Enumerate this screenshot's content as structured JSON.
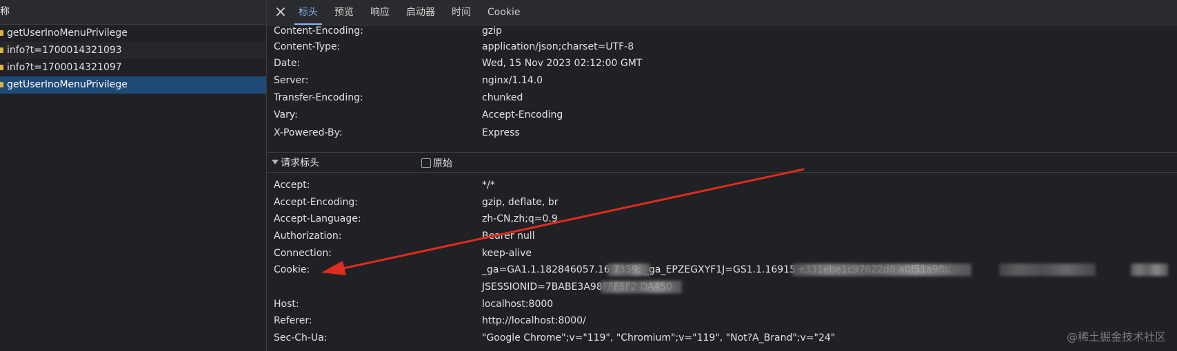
{
  "left_panel": {
    "header": "称",
    "requests": [
      {
        "name": "getUserInoMenuPrivilege"
      },
      {
        "name": "info?t=1700014321093"
      },
      {
        "name": "info?t=1700014321097"
      },
      {
        "name": "getUserInoMenuPrivilege"
      }
    ]
  },
  "tabs": {
    "close_icon": "×",
    "items": [
      {
        "label": "标头"
      },
      {
        "label": "预览"
      },
      {
        "label": "响应"
      },
      {
        "label": "启动器"
      },
      {
        "label": "时间"
      },
      {
        "label": "Cookie"
      }
    ]
  },
  "response_headers": [
    {
      "key": "Content-Encoding:",
      "value": "gzip"
    },
    {
      "key": "Content-Type:",
      "value": "application/json;charset=UTF-8"
    },
    {
      "key": "Date:",
      "value": "Wed, 15 Nov 2023 02:12:00 GMT"
    },
    {
      "key": "Server:",
      "value": "nginx/1.14.0"
    },
    {
      "key": "Transfer-Encoding:",
      "value": "chunked"
    },
    {
      "key": "Vary:",
      "value": "Accept-Encoding"
    },
    {
      "key": "X-Powered-By:",
      "value": "Express"
    }
  ],
  "request_section": {
    "title": "请求标头",
    "raw_label": "原始"
  },
  "request_headers": [
    {
      "key": "Accept:",
      "value": "*/*"
    },
    {
      "key": "Accept-Encoding:",
      "value": "gzip, deflate, br"
    },
    {
      "key": "Accept-Language:",
      "value": "zh-CN,zh;q=0.9"
    },
    {
      "key": "Authorization:",
      "value": "Bearer null"
    },
    {
      "key": "Connection:",
      "value": "keep-alive"
    },
    {
      "key": "Cookie:",
      "value": "_ga=GA1.1.182846057.16          7359; _ga_EPZEGXYF1J=GS1.1.16915                                                      e331ebe1c97622d0          a0f51a9fb;"
    },
    {
      "key": "",
      "value": "JSESSIONID=7BABE3A98FFF5F2          DA450"
    },
    {
      "key": "Host:",
      "value": "localhost:8000"
    },
    {
      "key": "Referer:",
      "value": "http://localhost:8000/"
    },
    {
      "key": "Sec-Ch-Ua:",
      "value": "\"Google Chrome\";v=\"119\", \"Chromium\";v=\"119\", \"Not?A_Brand\";v=\"24\""
    }
  ],
  "watermark": "@稀土掘金技术社区",
  "colors": {
    "background": "#202124",
    "selected_row": "#1f4a78",
    "active_tab": "#8ab4f8",
    "arrow": "#e02b20"
  }
}
